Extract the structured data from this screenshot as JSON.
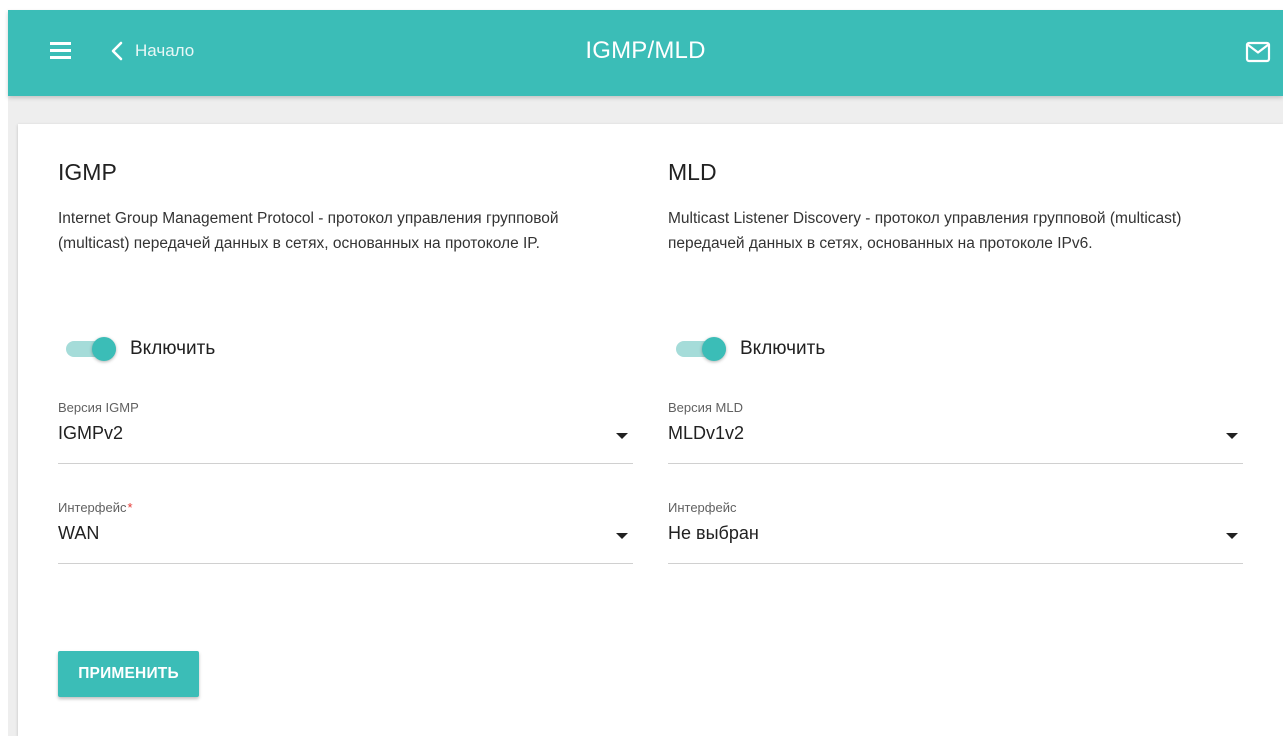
{
  "header": {
    "title": "IGMP/MLD",
    "back_label": "Начало",
    "menu_icon": "hamburger-menu-icon",
    "back_icon": "chevron-left-icon",
    "mail_icon": "mail-envelope-icon"
  },
  "igmp": {
    "title": "IGMP",
    "description": "Internet Group Management Protocol - протокол управления групповой (multicast) передачей данных в сетях, основанных на протоколе IP.",
    "enable_label": "Включить",
    "enabled": true,
    "version_label": "Версия IGMP",
    "version_value": "IGMPv2",
    "interface_label": "Интерфейс",
    "interface_required_mark": "*",
    "interface_value": "WAN"
  },
  "mld": {
    "title": "MLD",
    "description": "Multicast Listener Discovery - протокол управления групповой (multicast) передачей данных в сетях, основанных на протоколе IPv6.",
    "enable_label": "Включить",
    "enabled": true,
    "version_label": "Версия MLD",
    "version_value": "MLDv1v2",
    "interface_label": "Интерфейс",
    "interface_value": "Не выбран"
  },
  "actions": {
    "apply_label": "ПРИМЕНИТЬ"
  },
  "colors": {
    "accent": "#3bbdb7",
    "toggle_track": "#a5dcd9",
    "required": "#e53935"
  }
}
